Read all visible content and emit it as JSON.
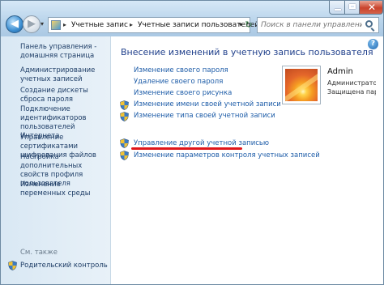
{
  "titlebar": {
    "breadcrumbs": [
      "Учетные запис",
      "Учетные записи пользователей"
    ],
    "search_placeholder": "Поиск в панели управления"
  },
  "window_controls": {
    "close_glyph": "✕"
  },
  "nav": {
    "back_glyph": "◀",
    "forward_glyph": "▶",
    "dropdown_glyph": "▾",
    "refresh_glyph": "↻"
  },
  "left_pane": {
    "home_link": "Панель управления -\nдомашняя страница",
    "tasks": [
      "Администрирование учетных записей",
      "Создание дискеты сброса пароля",
      "Подключение идентификаторов пользователей Интернета",
      "Управление сертификатами шифрования файлов",
      "Настройка дополнительных свойств профиля пользователя",
      "Изменение переменных среды"
    ],
    "see_also": "См. также",
    "parental_control": "Родительский контроль"
  },
  "main": {
    "help_glyph": "?",
    "title": "Внесение изменений в учетную запись пользователя",
    "links": [
      {
        "label": "Изменение своего пароля",
        "icon": "none"
      },
      {
        "label": "Удаление своего пароля",
        "icon": "none"
      },
      {
        "label": "Изменение своего рисунка",
        "icon": "none"
      },
      {
        "label": "Изменение имени своей учетной записи",
        "icon": "uac-shield-icon"
      },
      {
        "label": "Изменение типа своей учетной записи",
        "icon": "uac-shield-icon"
      }
    ],
    "other_links": [
      {
        "label": "Управление другой учетной записью",
        "icon": "uac-shield-icon"
      },
      {
        "label": "Изменение параметров контроля учетных записей",
        "icon": "uac-shield-icon"
      }
    ],
    "account": {
      "name": "Admin",
      "type": "Администратор",
      "password_state": "Защищена паролем"
    }
  },
  "colors": {
    "link": "#1d5ca8",
    "title": "#1f3f8b",
    "highlight_underline": "#e0161a"
  }
}
